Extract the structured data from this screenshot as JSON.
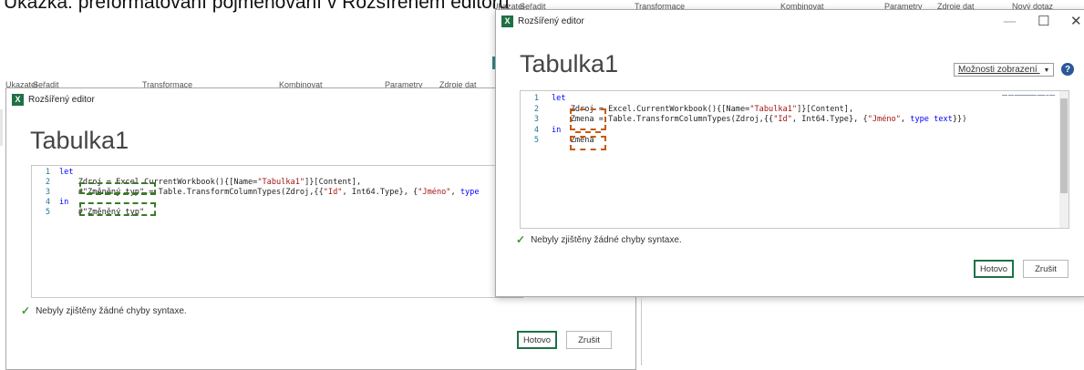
{
  "caption": "Ukázka: přeformátování pojmenování v Rozšířeném editoru",
  "back_ribbon": [
    "Ukazatel",
    "Seřadit",
    "Transformace",
    "Kombinovat",
    "Parametry",
    "Zdroje dat"
  ],
  "front_ribbon": [
    "Ukazatel",
    "Seřadit",
    "Transformace",
    "Kombinovat",
    "Parametry",
    "Zdroje dat",
    "Nový dotaz"
  ],
  "left_editor": {
    "window_title": "Rozšířený editor",
    "query_title": "Tabulka1",
    "lines": [
      {
        "n": "1",
        "parts": [
          {
            "t": "let",
            "c": "kw"
          }
        ]
      },
      {
        "n": "2",
        "parts": [
          {
            "t": "    Zdroj = Excel.CurrentWorkbook(){[Name=",
            "c": ""
          },
          {
            "t": "\"Tabulka1\"",
            "c": "str"
          },
          {
            "t": "]}[Content],",
            "c": ""
          }
        ]
      },
      {
        "n": "3",
        "parts": [
          {
            "t": "    #\"Změněný typ\" = Table.TransformColumnTypes(Zdroj,{{",
            "c": ""
          },
          {
            "t": "\"Id\"",
            "c": "str"
          },
          {
            "t": ", Int64.Type}, {",
            "c": ""
          },
          {
            "t": "\"Jméno\"",
            "c": "str"
          },
          {
            "t": ", ",
            "c": ""
          },
          {
            "t": "type",
            "c": "kw"
          }
        ]
      },
      {
        "n": "4",
        "parts": [
          {
            "t": "in",
            "c": "kw"
          }
        ]
      },
      {
        "n": "5",
        "parts": [
          {
            "t": "    #\"Změněný typ\"",
            "c": ""
          }
        ]
      }
    ],
    "status": "Nebyly zjištěny žádné chyby syntaxe.",
    "done_button": "Hotovo",
    "cancel_button": "Zrušit"
  },
  "right_editor": {
    "window_title": "Rozšířený editor",
    "query_title": "Tabulka1",
    "view_options": "Možnosti zobrazení",
    "lines": [
      {
        "n": "1",
        "parts": [
          {
            "t": "let",
            "c": "kw"
          }
        ]
      },
      {
        "n": "2",
        "parts": [
          {
            "t": "    Zdroj = Excel.CurrentWorkbook(){[Name=",
            "c": ""
          },
          {
            "t": "\"Tabulka1\"",
            "c": "str"
          },
          {
            "t": "]}[Content],",
            "c": ""
          }
        ]
      },
      {
        "n": "3",
        "parts": [
          {
            "t": "    Zmena = Table.TransformColumnTypes(Zdroj,{{",
            "c": ""
          },
          {
            "t": "\"Id\"",
            "c": "str"
          },
          {
            "t": ", Int64.Type}, {",
            "c": ""
          },
          {
            "t": "\"Jméno\"",
            "c": "str"
          },
          {
            "t": ", ",
            "c": ""
          },
          {
            "t": "type",
            "c": "kw"
          },
          {
            "t": " ",
            "c": ""
          },
          {
            "t": "text",
            "c": "kw"
          },
          {
            "t": "}})",
            "c": ""
          }
        ]
      },
      {
        "n": "4",
        "parts": [
          {
            "t": "in",
            "c": "kw"
          }
        ]
      },
      {
        "n": "5",
        "parts": [
          {
            "t": "    Zmena",
            "c": ""
          }
        ]
      }
    ],
    "status": "Nebyly zjištěny žádné chyby syntaxe.",
    "done_button": "Hotovo",
    "cancel_button": "Zrušit"
  },
  "icons": {
    "excel": "excel-app-icon",
    "help": "help-icon",
    "check": "checkmark-icon",
    "dropdown": "chevron-down-icon",
    "minimize": "minimize-icon",
    "maximize": "maximize-icon",
    "close": "close-icon"
  },
  "colors": {
    "keyword": "#0000ff",
    "string": "#a31515",
    "line_number": "#237893",
    "highlight_green": "#3a7a27",
    "highlight_orange": "#c55a11",
    "excel_green": "#1e7145"
  }
}
